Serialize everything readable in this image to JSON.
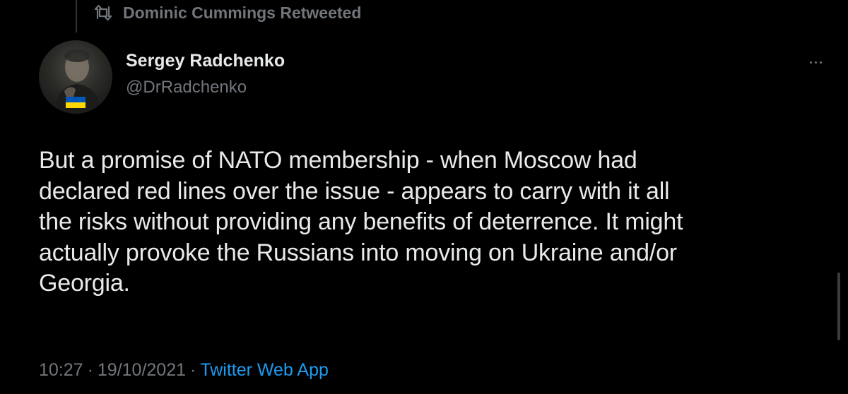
{
  "retweet": {
    "icon": "retweet-icon",
    "text": "Dominic Cummings Retweeted"
  },
  "author": {
    "name": "Sergey Radchenko",
    "handle": "@DrRadchenko",
    "avatar_badge": "ukraine-flag",
    "badge_colors": [
      "#0057b7",
      "#ffd700"
    ]
  },
  "more_icon": "more-horizontal-icon",
  "tweet": {
    "lines": [
      "But a promise of NATO membership - when Moscow had",
      "declared red lines over the issue - appears to carry with it all",
      "the risks without providing any benefits of deterrence. It might",
      "actually provoke the Russians into moving on Ukraine and/or",
      "Georgia."
    ]
  },
  "meta": {
    "time": "10:27",
    "separator": "·",
    "date": "19/10/2021",
    "source": "Twitter Web App"
  },
  "colors": {
    "background": "#000000",
    "primary_text": "#e7e9ea",
    "secondary_text": "#71767b",
    "link": "#1d9bf0"
  }
}
